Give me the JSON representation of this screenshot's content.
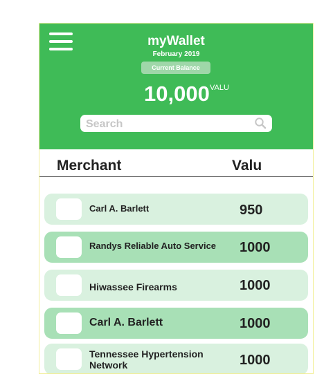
{
  "header": {
    "title": "myWallet",
    "subtitle": "February 2019",
    "balance_label": "Current Balance",
    "balance": "10,000",
    "balance_unit": "VALU",
    "background_color": "#3fbb57"
  },
  "search": {
    "placeholder": "Search",
    "value": ""
  },
  "columns": {
    "merchant": "Merchant",
    "value": "Valu"
  },
  "transactions": [
    {
      "merchant": "Carl A. Barlett",
      "amount": "950"
    },
    {
      "merchant": "Randys Reliable Auto Service",
      "amount": "1000"
    },
    {
      "merchant": "Hiwassee Firearms",
      "amount": "1000"
    },
    {
      "merchant": "Carl A. Barlett",
      "amount": "1000"
    },
    {
      "merchant": "Tennessee Hypertension Network",
      "amount": "1000"
    }
  ],
  "icons": {
    "menu": "hamburger-menu-icon",
    "search": "search-icon"
  },
  "colors": {
    "row_light": "#d9f1df",
    "row_dark": "#a8e0b6"
  }
}
